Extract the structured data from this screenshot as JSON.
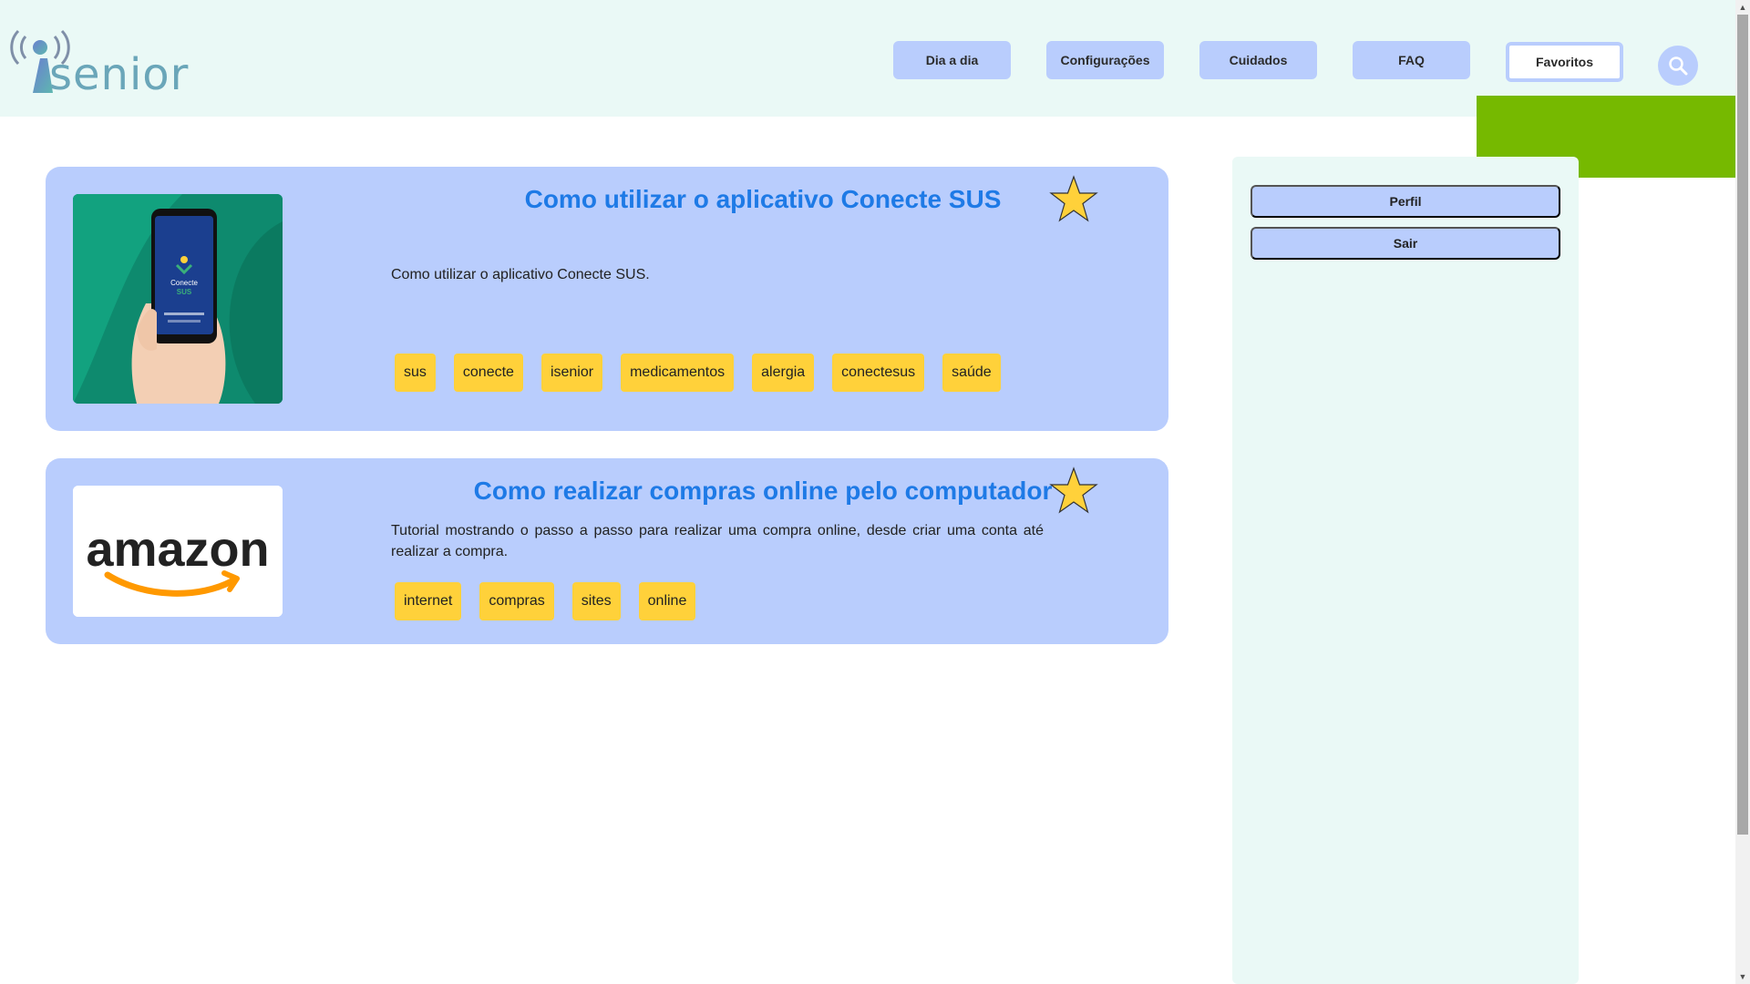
{
  "logo": {
    "text": "senior",
    "brand": "isenior"
  },
  "nav": {
    "items": [
      {
        "label": "Dia a dia"
      },
      {
        "label": "Configurações"
      },
      {
        "label": "Cuidados"
      },
      {
        "label": "FAQ"
      },
      {
        "label": "Favoritos"
      }
    ],
    "active": "Favoritos",
    "search_icon": "search-icon"
  },
  "cards": [
    {
      "title": "Como utilizar o aplicativo Conecte SUS",
      "description": "Como utilizar o aplicativo Conecte SUS.",
      "tags": [
        "sus",
        "conecte",
        "isenior",
        "medicamentos",
        "alergia",
        "conectesus",
        "saúde"
      ],
      "favorite_icon": "star-icon",
      "image_text": [
        "Conecte",
        "SUS"
      ]
    },
    {
      "title": "Como realizar compras online pelo computador",
      "description": "Tutorial mostrando o passo a passo para realizar uma compra online, desde criar uma conta até realizar a compra.",
      "tags": [
        "internet",
        "compras",
        "sites",
        "online"
      ],
      "favorite_icon": "star-icon",
      "image_text": [
        "amazon"
      ]
    }
  ],
  "sidebar": {
    "buttons": [
      {
        "label": "Perfil"
      },
      {
        "label": "Sair"
      }
    ]
  },
  "colors": {
    "header_bg": "#eaf9f6",
    "card_bg": "#b9cdfd",
    "title": "#1e7ae6",
    "tag": "#ffd13a",
    "star": "#ffd13a",
    "green_block": "#76b900"
  }
}
